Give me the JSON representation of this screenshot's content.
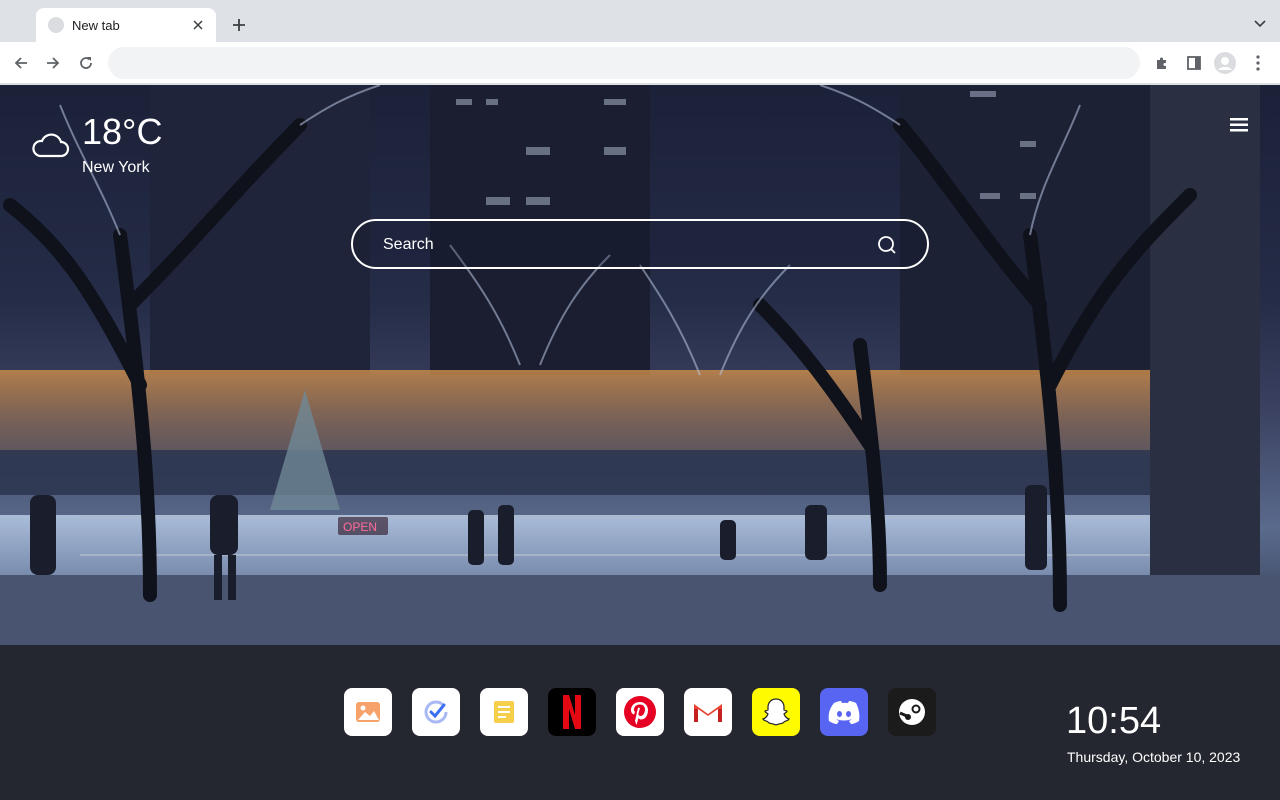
{
  "tab": {
    "title": "New tab",
    "favicon": "blank-page-icon"
  },
  "toolbar": {
    "omnibox_value": "",
    "icons": [
      "back-arrow-icon",
      "forward-arrow-icon",
      "reload-icon",
      "puzzle-icon",
      "side-panel-icon",
      "profile-avatar-icon",
      "kebab-menu-icon"
    ]
  },
  "weather": {
    "temperature": "18°C",
    "city": "New York",
    "icon": "cloud-icon"
  },
  "search": {
    "placeholder": "Search",
    "icon": "search-icon"
  },
  "sign": {
    "text": "OPEN"
  },
  "dock": {
    "apps": [
      {
        "name": "Photos",
        "icon": "image-icon",
        "bg": "#ffffff",
        "accent": "#f4733d"
      },
      {
        "name": "Tasks",
        "icon": "progress-check-icon",
        "bg": "#ffffff",
        "accent": "#3d6ff5"
      },
      {
        "name": "Notes",
        "icon": "note-icon",
        "bg": "#ffffff",
        "accent": "#f1c232"
      },
      {
        "name": "Netflix",
        "icon": "netflix-icon",
        "bg": "#000000",
        "accent": "#e50914"
      },
      {
        "name": "Pinterest",
        "icon": "pinterest-icon",
        "bg": "#ffffff",
        "accent": "#e60023"
      },
      {
        "name": "Gmail",
        "icon": "gmail-icon",
        "bg": "#ffffff",
        "accent": "#ea4335"
      },
      {
        "name": "Snapchat",
        "icon": "snapchat-icon",
        "bg": "#fffc00",
        "accent": "#ffffff"
      },
      {
        "name": "Discord",
        "icon": "discord-icon",
        "bg": "#5865f2",
        "accent": "#ffffff"
      },
      {
        "name": "Steam",
        "icon": "steam-icon",
        "bg": "#1b1b1b",
        "accent": "#ffffff"
      }
    ]
  },
  "clock": {
    "time": "10:54",
    "date": "Thursday, October 10, 2023"
  }
}
